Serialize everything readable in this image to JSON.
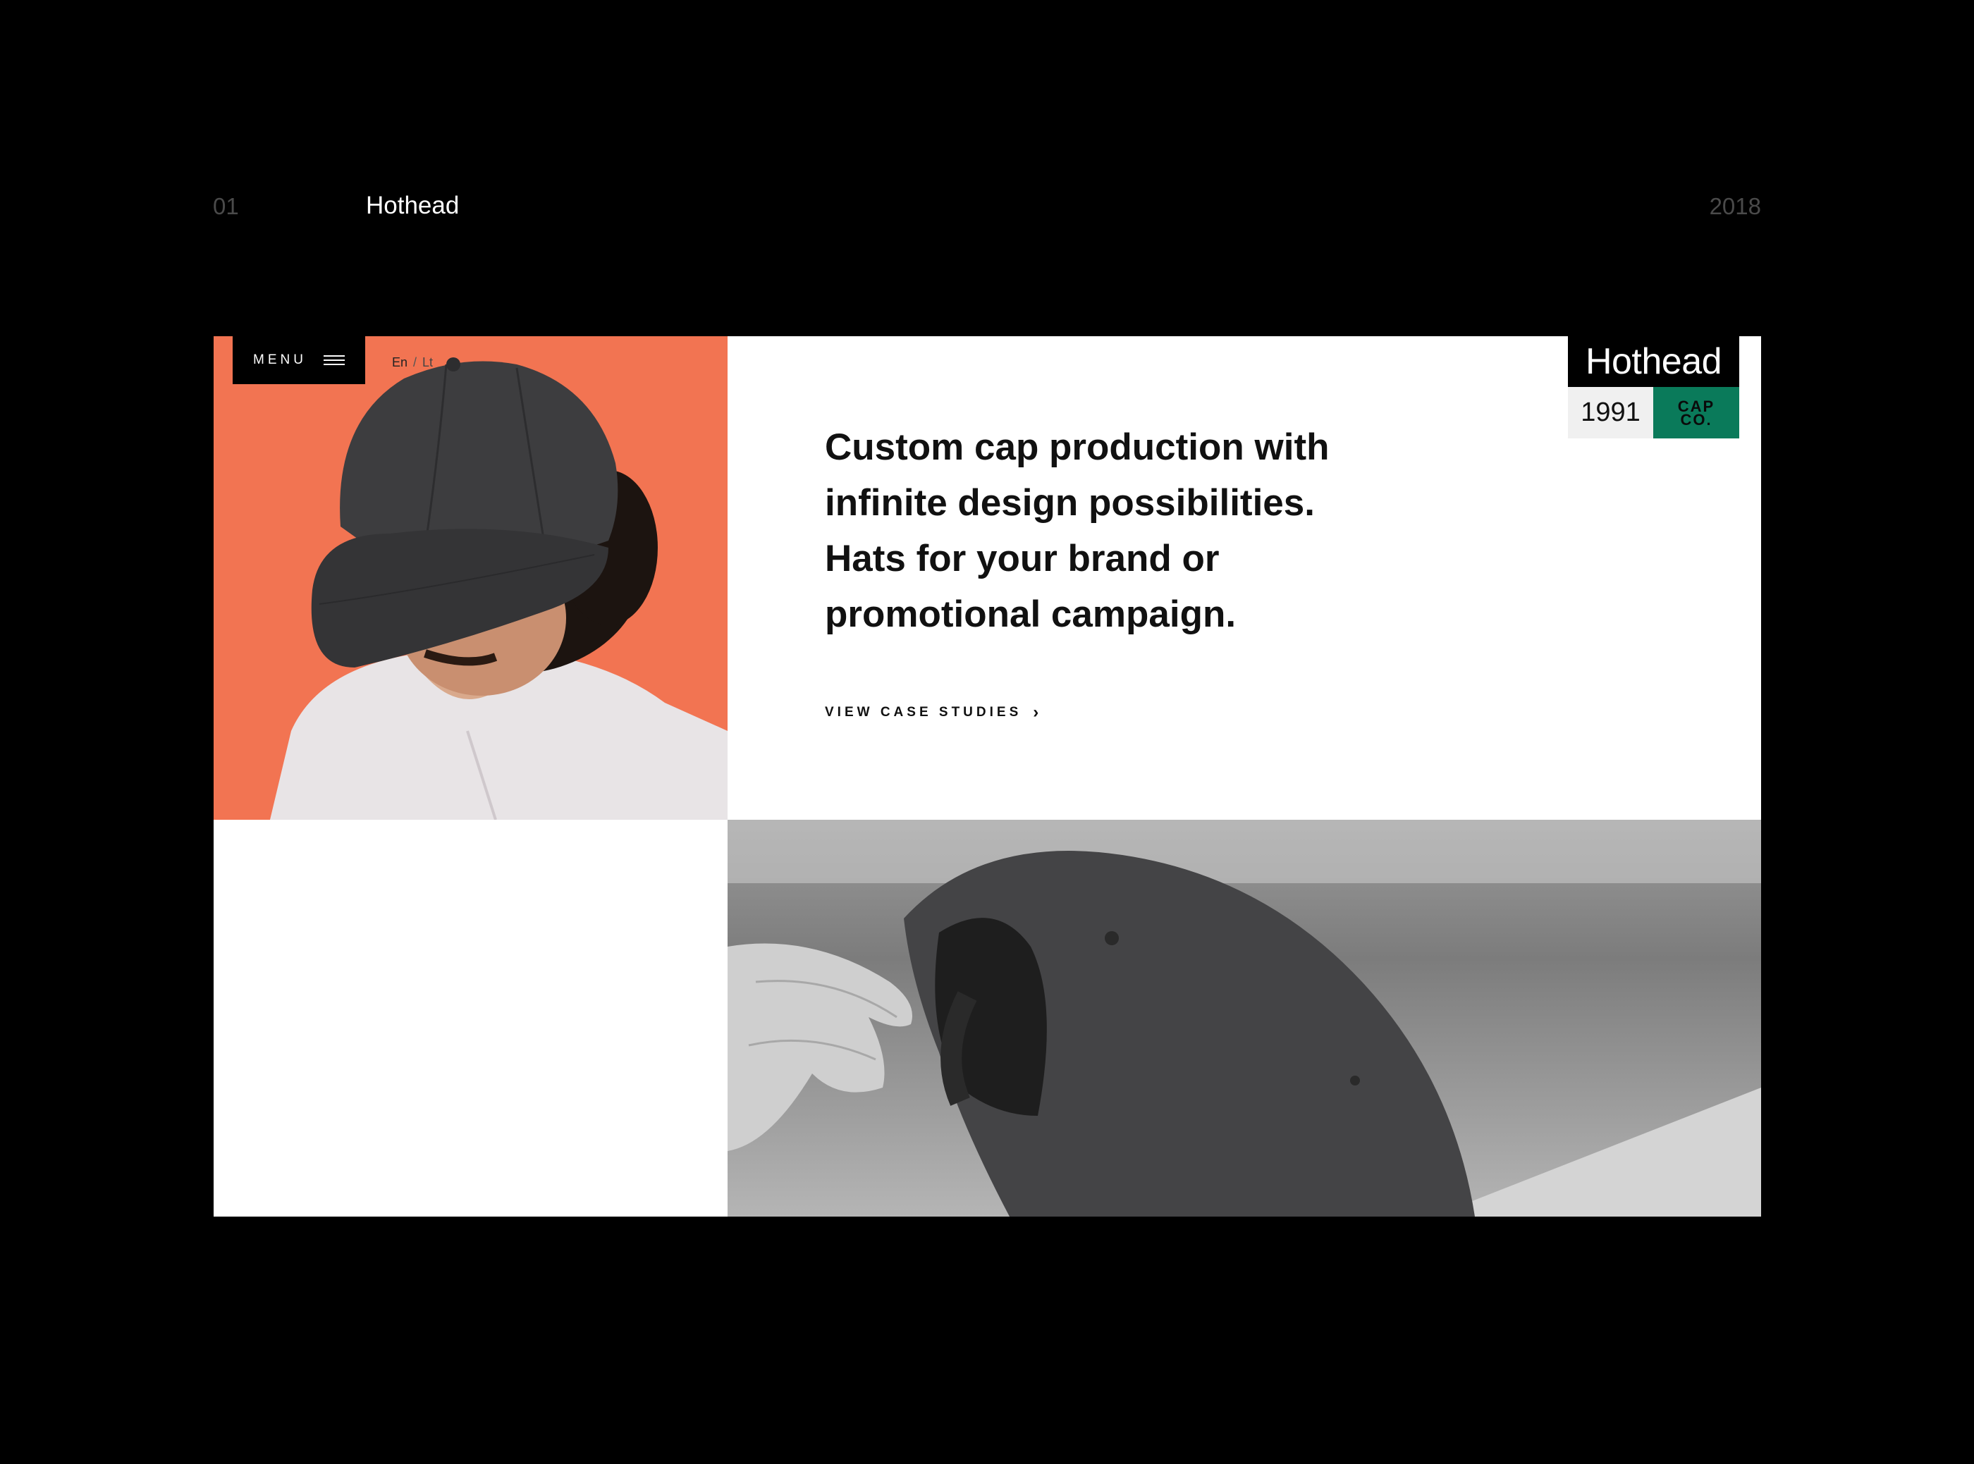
{
  "case": {
    "number": "01",
    "title": "Hothead",
    "year": "2018"
  },
  "site": {
    "menu_label": "MENU",
    "lang": {
      "en": "En",
      "separator": "/",
      "lt": "Lt"
    },
    "logo": {
      "name": "Hothead",
      "year": "1991",
      "cap_line1": "CAP",
      "cap_line2": "CO."
    },
    "headline": [
      "Custom cap production with",
      "infinite design possibilities.",
      "Hats for your brand or",
      "promotional campaign."
    ],
    "cta_label": "VIEW CASE STUDIES",
    "cta_icon": "chevron-right-icon",
    "colors": {
      "hero_bg": "#f27452",
      "logo_green": "#0a7a5a",
      "page_bg": "#000000"
    }
  }
}
